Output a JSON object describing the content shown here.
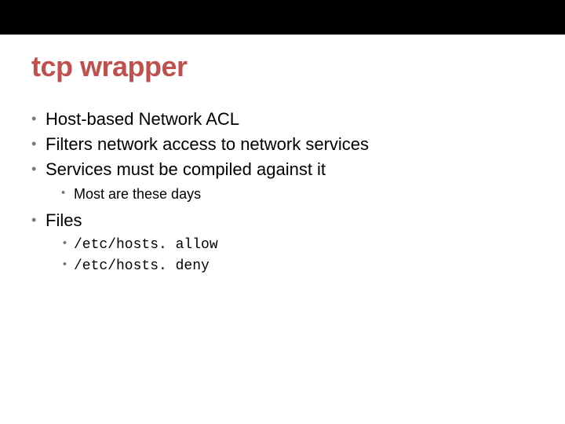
{
  "title": "tcp wrapper",
  "bullets": {
    "b0": "Host-based Network ACL",
    "b1": "Filters network access to network services",
    "b2": "Services must be compiled against it",
    "b2_sub0": "Most are these days",
    "b3": "Files",
    "b3_sub0": "/etc/hosts. allow",
    "b3_sub1": "/etc/hosts. deny"
  }
}
